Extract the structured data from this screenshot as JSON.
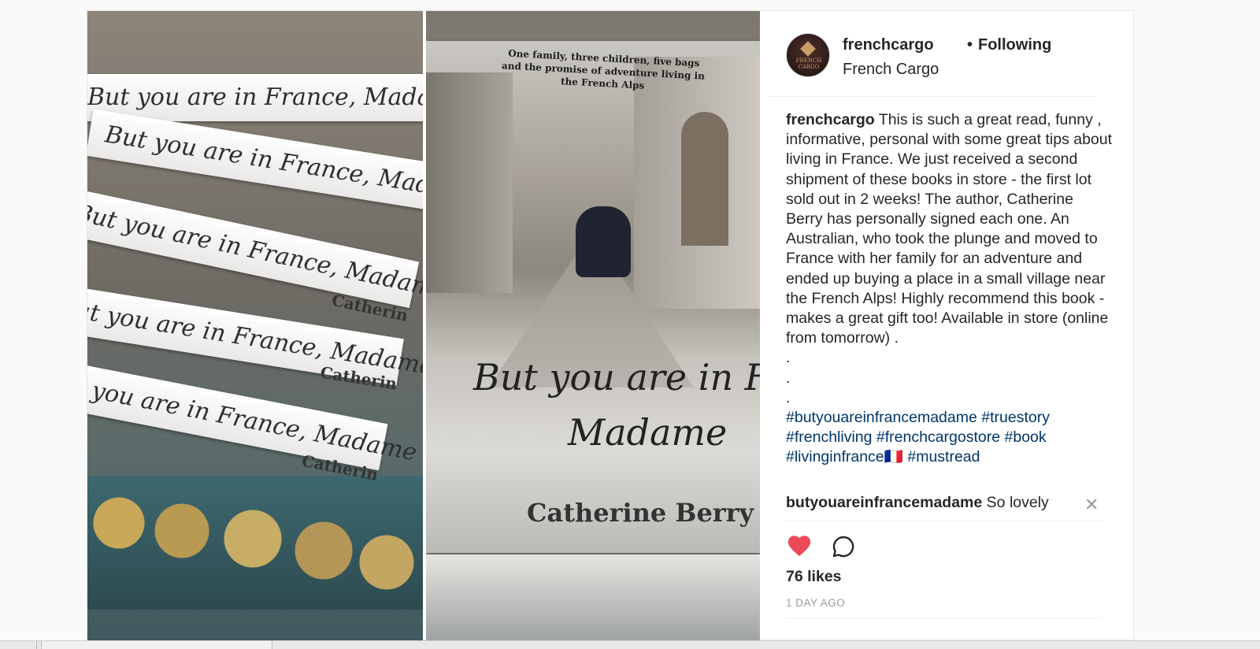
{
  "post": {
    "images": [
      {
        "alt": "stack-of-books-photo"
      },
      {
        "alt": "book-cover-photo"
      }
    ],
    "book": {
      "tagline": "One family, three children, five bags and the promise of adventure living in the French Alps",
      "spine_title": "But you are in France, Madame",
      "spine_author": "Catherin",
      "cover_title_line1": "But you are in Franc",
      "cover_title_line2": "Madame",
      "cover_author": "Catherine Berry"
    }
  },
  "header": {
    "username": "frenchcargo",
    "separator": "•",
    "follow_status": "Following",
    "full_name": "French Cargo",
    "avatar_text": "FRENCH CARGO"
  },
  "caption": {
    "username": "frenchcargo",
    "text": "This is such a great read, funny , informative, personal with some great tips about living in France. We just received a second shipment of these books in store - the first lot sold out in 2 weeks! The author, Catherine Berry has personally signed each one. An Australian, who took the plunge and moved to France with her family for an adventure and ended up buying a place in a small village near the French Alps! Highly recommend this book - makes a great gift too! Available in store (online from tomorrow) .",
    "dots": [
      ".",
      ".",
      "."
    ],
    "hashtags": [
      "#butyouareinfrancemadame",
      "#truestory",
      "#frenchliving",
      "#frenchcargostore",
      "#book",
      "#livinginfrance🇫🇷",
      "#mustread"
    ]
  },
  "comment": {
    "username": "butyouareinfrancemadame",
    "text": "So lovely",
    "close_glyph": "✕"
  },
  "actions": {
    "like_icon": "heart-filled-icon",
    "comment_icon": "speech-bubble-icon",
    "like_color": "#ed4956"
  },
  "likes": "76 likes",
  "timestamp": "1 DAY AGO"
}
